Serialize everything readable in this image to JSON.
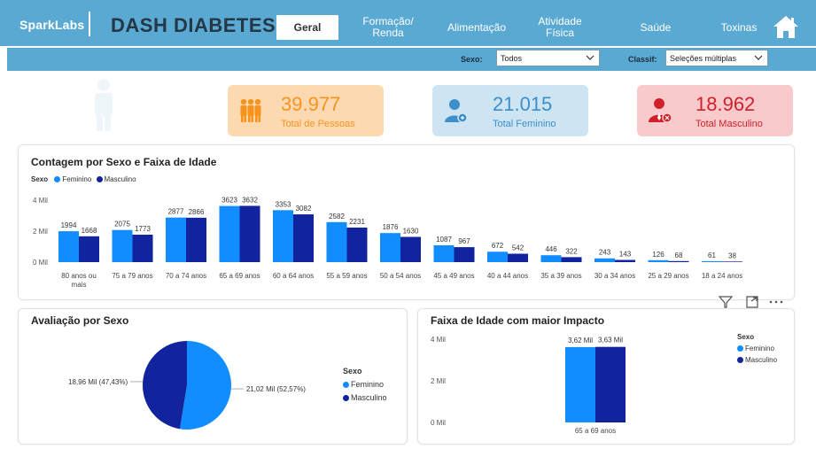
{
  "header": {
    "brand": "SparkLabs",
    "title": "DASH DIABETES",
    "tabs": [
      {
        "label": "Geral",
        "active": true
      },
      {
        "label": "Formação/ Renda"
      },
      {
        "label": "Alimentação"
      },
      {
        "label": "Atividade Física"
      },
      {
        "label": "Saúde"
      },
      {
        "label": "Toxinas"
      }
    ],
    "home_icon": "home-icon"
  },
  "filters": {
    "sexo_label": "Sexo:",
    "sexo_value": "Todos",
    "classif_label": "Classif:",
    "classif_value": "Seleções múltiplas"
  },
  "kpis": {
    "total": {
      "value": "39.977",
      "label": "Total de Pessoas",
      "icon": "people-group-icon",
      "color": "#f7941d",
      "bg": "#fcd9b1"
    },
    "female": {
      "value": "21.015",
      "label": "Total Feminino",
      "icon": "female-user-icon",
      "color": "#3e8ec9",
      "bg": "#cde5f3"
    },
    "male": {
      "value": "18.962",
      "label": "Total Masculino",
      "icon": "male-user-icon",
      "color": "#d0202a",
      "bg": "#f9cacb"
    }
  },
  "colors": {
    "feminino": "#118dff",
    "masculino": "#12239e"
  },
  "chart_data": [
    {
      "type": "bar",
      "title": "Contagem por Sexo e Faixa de Idade",
      "legend_title": "Sexo",
      "legend_position": "top-left",
      "categories": [
        "80 anos ou mais",
        "75 a 79 anos",
        "70 a 74 anos",
        "65 a 69 anos",
        "60 a 64 anos",
        "55 a 59 anos",
        "50 a 54 anos",
        "45 a 49 anos",
        "40 a 44 anos",
        "35 a 39 anos",
        "30 a 34 anos",
        "25 a 29 anos",
        "18 a 24 anos"
      ],
      "series": [
        {
          "name": "Feminino",
          "values": [
            1994,
            2075,
            2877,
            3623,
            3353,
            2582,
            1876,
            1087,
            672,
            446,
            243,
            126,
            61
          ]
        },
        {
          "name": "Masculino",
          "values": [
            1668,
            1773,
            2866,
            3632,
            3082,
            2231,
            1630,
            967,
            542,
            322,
            143,
            68,
            38
          ]
        }
      ],
      "yticks": [
        "0 Mil",
        "2 Mil",
        "4 Mil"
      ],
      "ylim": [
        0,
        4000
      ]
    },
    {
      "type": "pie",
      "title": "Avaliação por Sexo",
      "legend_title": "Sexo",
      "legend_position": "right",
      "slices": [
        {
          "name": "Feminino",
          "value": 21015,
          "label": "21,02 Mil (52,57%)"
        },
        {
          "name": "Masculino",
          "value": 18962,
          "label": "18,96 Mil (47,43%)"
        }
      ]
    },
    {
      "type": "bar",
      "title": "Faixa de Idade com maior Impacto",
      "legend_title": "Sexo",
      "legend_position": "right",
      "categories": [
        "65 a 69 anos"
      ],
      "series": [
        {
          "name": "Feminino",
          "values": [
            3620
          ],
          "label": "3,62 Mil"
        },
        {
          "name": "Masculino",
          "values": [
            3630
          ],
          "label": "3,63 Mil"
        }
      ],
      "yticks": [
        "0 Mil",
        "2 Mil",
        "4 Mil"
      ],
      "ylim": [
        0,
        4000
      ]
    }
  ]
}
